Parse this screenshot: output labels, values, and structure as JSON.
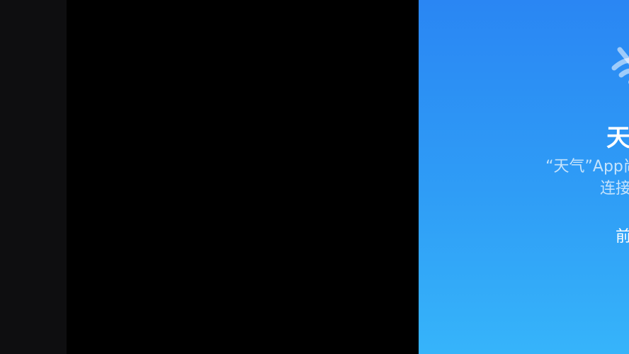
{
  "weather_panel": {
    "icon": "wifi-slash-icon",
    "title": "天气",
    "message_line1": "“天气”App尚未接入互联",
    "message_line2": "连接情况",
    "settings_link": "前往"
  },
  "colors": {
    "panel_top": "#2a86f3",
    "panel_bottom": "#36b4fa",
    "side_strip": "#0e0e10",
    "background": "#000000"
  }
}
